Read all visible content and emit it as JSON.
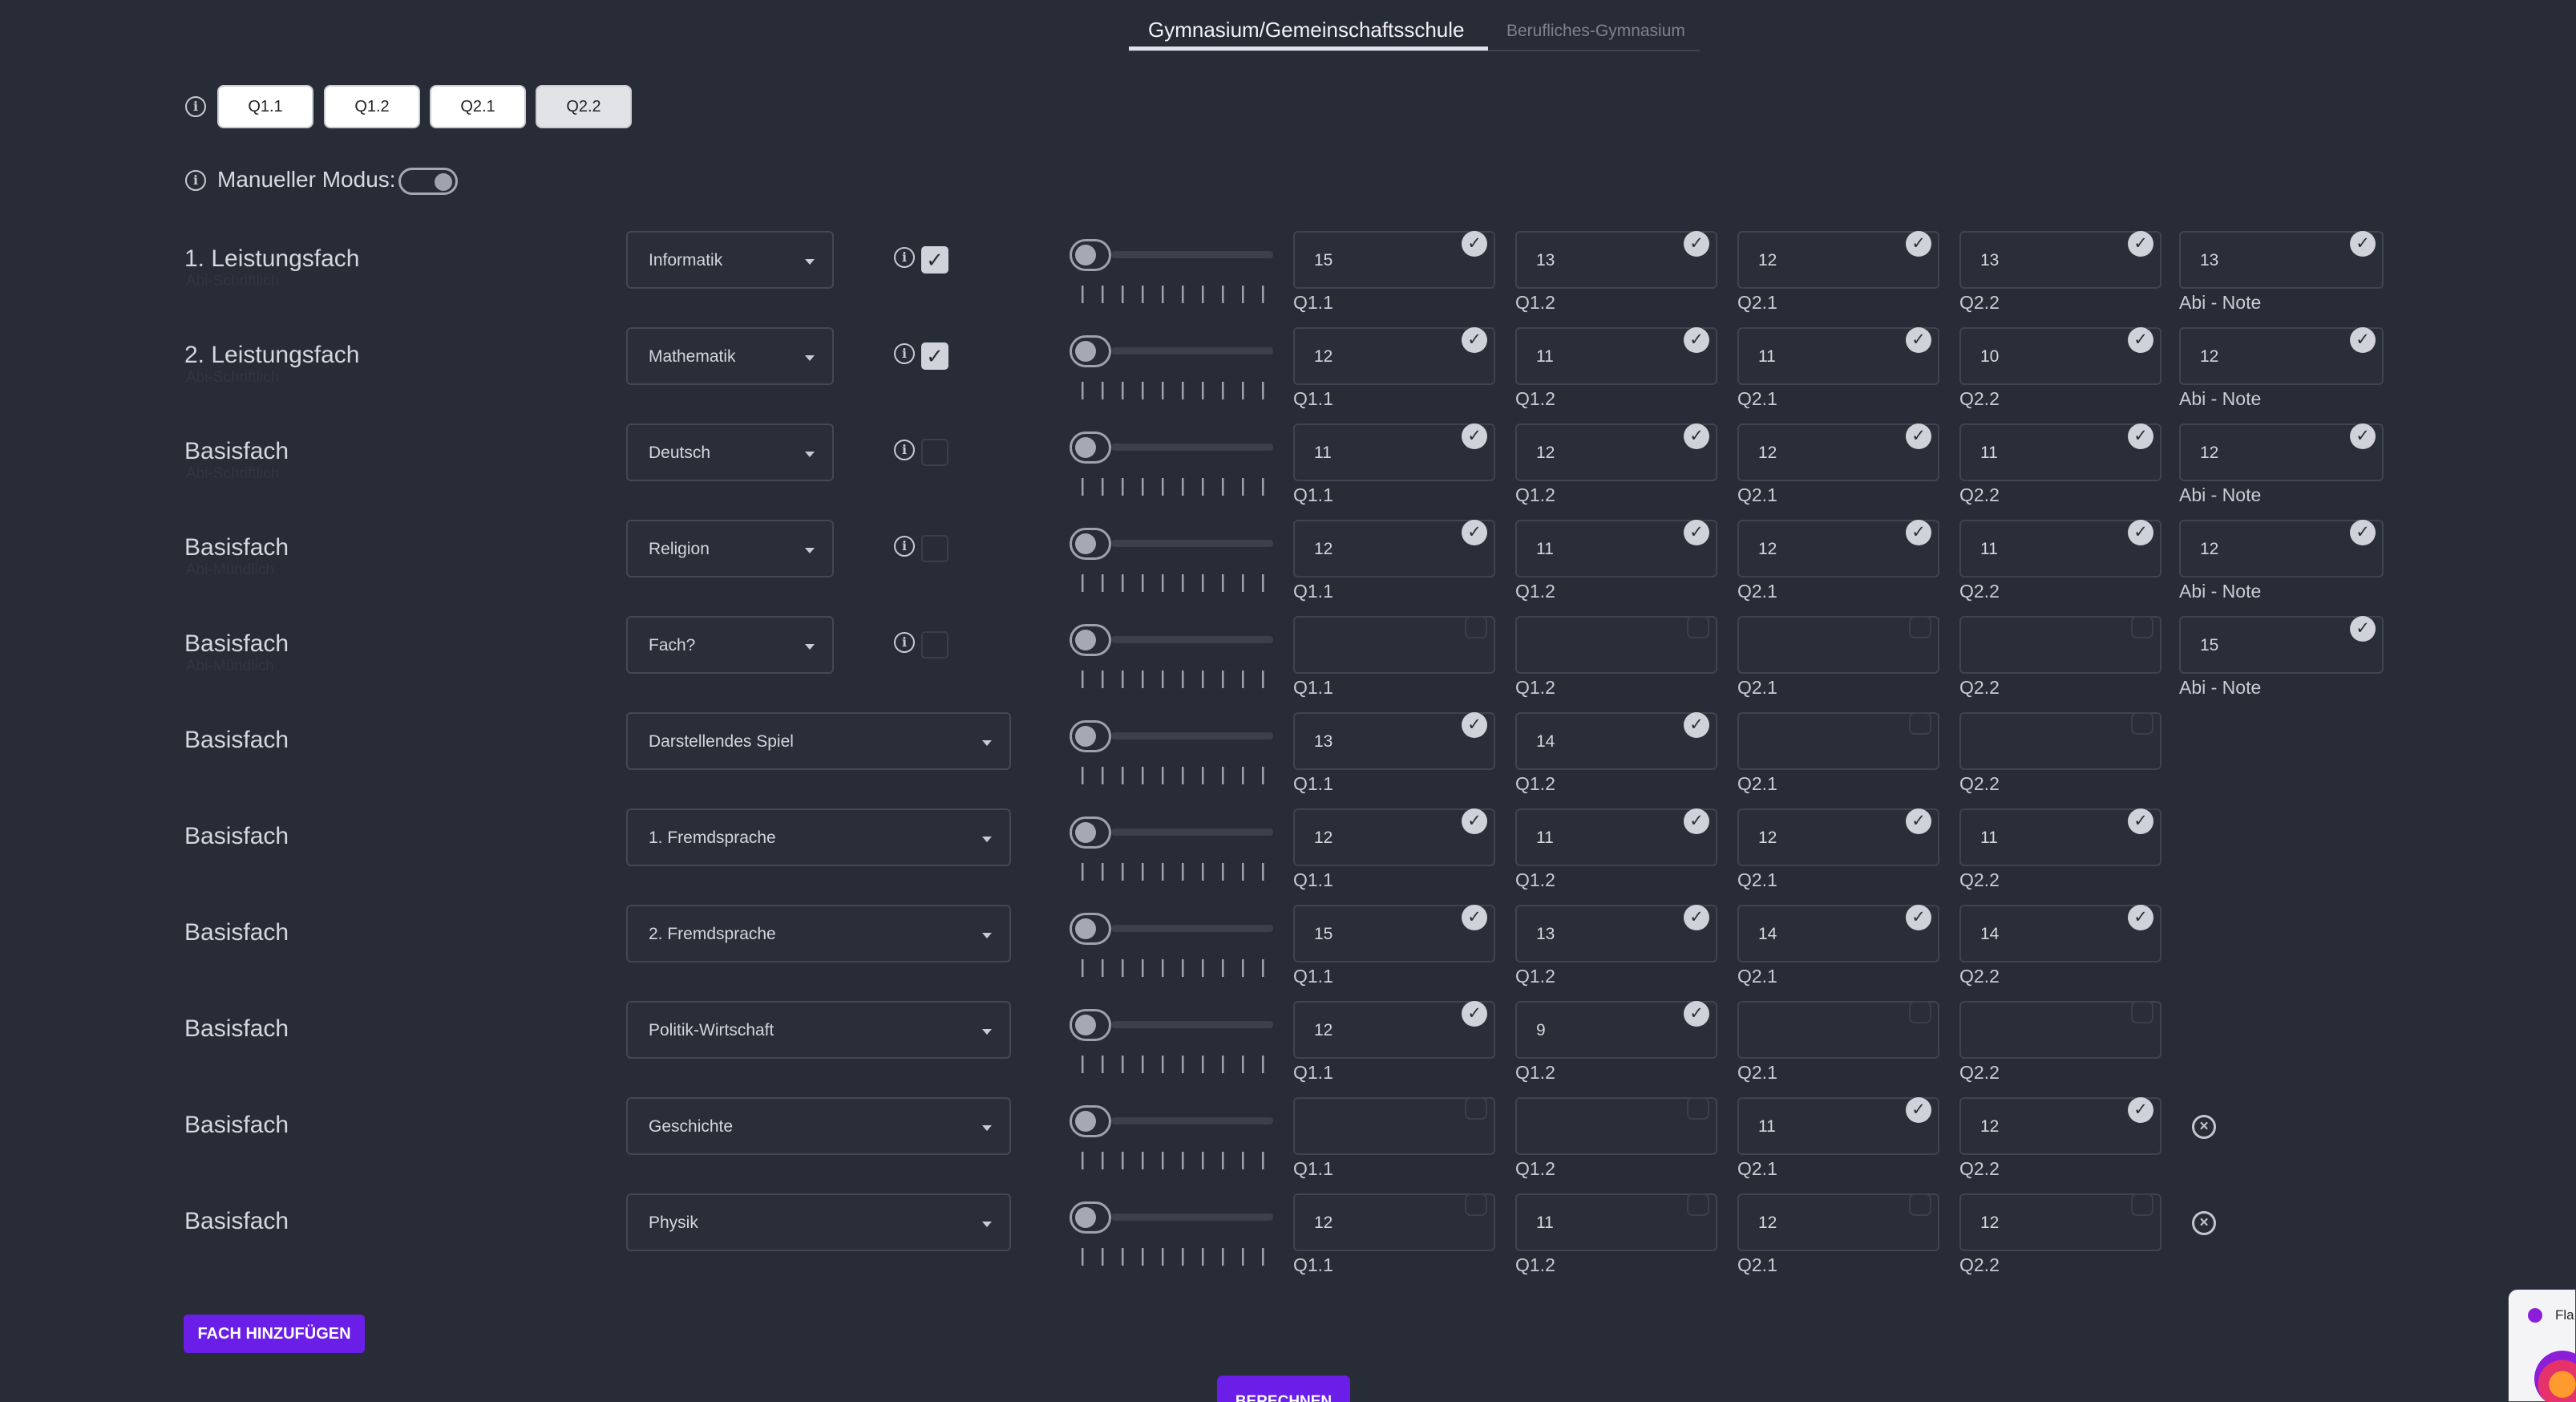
{
  "tabs": {
    "active": "Gymnasium/Gemeinschaftsschule",
    "inactive": "Berufliches-Gymnasium"
  },
  "semesters": [
    "Q1.1",
    "Q1.2",
    "Q2.1",
    "Q2.2"
  ],
  "selected_semester": "Q2.2",
  "manual_mode": {
    "label": "Manueller Modus:",
    "on": true
  },
  "field_labels": {
    "q11": "Q1.1",
    "q12": "Q1.2",
    "q21": "Q2.1",
    "q22": "Q2.2",
    "abi": "Abi - Note"
  },
  "rows": [
    {
      "label": "1. Leistungsfach",
      "ghost": "Abi-Schriftlich",
      "subject": "Informatik",
      "abi_check": true,
      "q11": "15",
      "q12": "13",
      "q21": "12",
      "q22": "13",
      "abi": "13"
    },
    {
      "label": "2. Leistungsfach",
      "ghost": "Abi-Schriftlich",
      "subject": "Mathematik",
      "abi_check": true,
      "q11": "12",
      "q12": "11",
      "q21": "11",
      "q22": "10",
      "abi": "12"
    },
    {
      "label": "Basisfach",
      "ghost": "Abi-Schriftlich",
      "subject": "Deutsch",
      "abi_check": false,
      "q11": "11",
      "q12": "12",
      "q21": "12",
      "q22": "11",
      "abi": "12"
    },
    {
      "label": "Basisfach",
      "ghost": "Abi-Mündlich",
      "subject": "Religion",
      "abi_check": false,
      "q11": "12",
      "q12": "11",
      "q21": "12",
      "q22": "11",
      "abi": "12"
    },
    {
      "label": "Basisfach",
      "ghost": "Abi-Mündlich",
      "subject": "Fach?",
      "abi_check": false,
      "q11": "",
      "q12": "",
      "q21": "",
      "q22": "",
      "abi": "15"
    },
    {
      "label": "Basisfach",
      "subject": "Darstellendes Spiel",
      "q11": "13",
      "q12": "14",
      "q21": "",
      "q22": ""
    },
    {
      "label": "Basisfach",
      "subject": "1. Fremdsprache",
      "q11": "12",
      "q12": "11",
      "q21": "12",
      "q22": "11"
    },
    {
      "label": "Basisfach",
      "subject": "2. Fremdsprache",
      "q11": "15",
      "q12": "13",
      "q21": "14",
      "q22": "14"
    },
    {
      "label": "Basisfach",
      "subject": "Politik-Wirtschaft",
      "q11": "12",
      "q12": "9",
      "q21": "",
      "q22": ""
    },
    {
      "label": "Basisfach",
      "subject": "Geschichte",
      "q11": "",
      "q12": "",
      "q21": "11",
      "q22": "12"
    },
    {
      "label": "Basisfach",
      "subject": "Physik",
      "q11": "12",
      "q12": "11",
      "q21": "12",
      "q22": "12"
    }
  ],
  "add_button": "FACH HINZUFÜGEN",
  "calc_button": "BERECHNEN",
  "popup_title": "Fla"
}
